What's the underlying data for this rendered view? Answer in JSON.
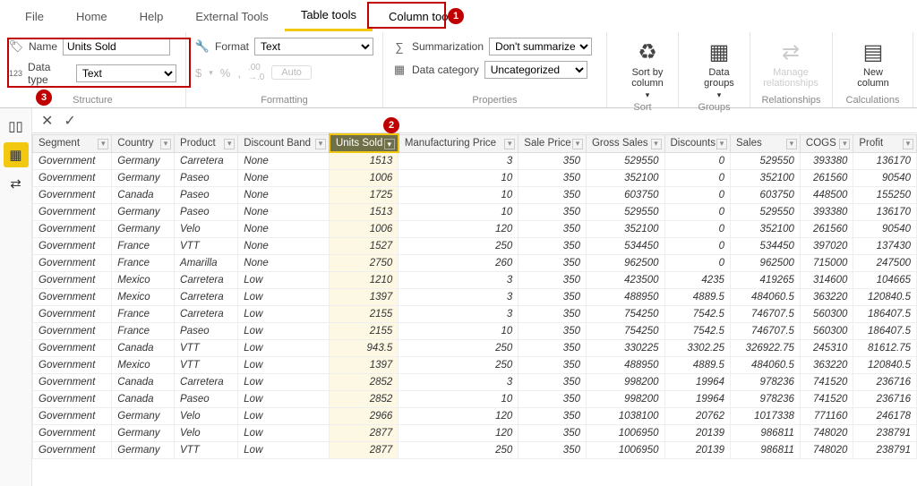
{
  "tabs": [
    "File",
    "Home",
    "Help",
    "External Tools",
    "Table tools",
    "Column tools"
  ],
  "structure": {
    "name_label": "Name",
    "name_value": "Units Sold",
    "datatype_label": "Data type",
    "datatype_value": "Text",
    "group": "Structure"
  },
  "formatting": {
    "format_label": "Format",
    "format_value": "Text",
    "auto": "Auto",
    "group": "Formatting"
  },
  "properties": {
    "sum_label": "Summarization",
    "sum_value": "Don't summarize",
    "cat_label": "Data category",
    "cat_value": "Uncategorized",
    "group": "Properties"
  },
  "sort": {
    "btn": "Sort by\ncolumn",
    "group": "Sort"
  },
  "groups": {
    "btn": "Data\ngroups",
    "group": "Groups"
  },
  "rel": {
    "btn": "Manage\nrelationships",
    "group": "Relationships"
  },
  "calc": {
    "btn": "New\ncolumn",
    "group": "Calculations"
  },
  "columns": [
    "Segment",
    "Country",
    "Product",
    "Discount Band",
    "Units Sold",
    "Manufacturing Price",
    "Sale Price",
    "Gross Sales",
    "Discounts",
    "Sales",
    "COGS",
    "Profit"
  ],
  "rows": [
    [
      "Government",
      "Germany",
      "Carretera",
      "None",
      "1513",
      "3",
      "350",
      "529550",
      "0",
      "529550",
      "393380",
      "136170"
    ],
    [
      "Government",
      "Germany",
      "Paseo",
      "None",
      "1006",
      "10",
      "350",
      "352100",
      "0",
      "352100",
      "261560",
      "90540"
    ],
    [
      "Government",
      "Canada",
      "Paseo",
      "None",
      "1725",
      "10",
      "350",
      "603750",
      "0",
      "603750",
      "448500",
      "155250"
    ],
    [
      "Government",
      "Germany",
      "Paseo",
      "None",
      "1513",
      "10",
      "350",
      "529550",
      "0",
      "529550",
      "393380",
      "136170"
    ],
    [
      "Government",
      "Germany",
      "Velo",
      "None",
      "1006",
      "120",
      "350",
      "352100",
      "0",
      "352100",
      "261560",
      "90540"
    ],
    [
      "Government",
      "France",
      "VTT",
      "None",
      "1527",
      "250",
      "350",
      "534450",
      "0",
      "534450",
      "397020",
      "137430"
    ],
    [
      "Government",
      "France",
      "Amarilla",
      "None",
      "2750",
      "260",
      "350",
      "962500",
      "0",
      "962500",
      "715000",
      "247500"
    ],
    [
      "Government",
      "Mexico",
      "Carretera",
      "Low",
      "1210",
      "3",
      "350",
      "423500",
      "4235",
      "419265",
      "314600",
      "104665"
    ],
    [
      "Government",
      "Mexico",
      "Carretera",
      "Low",
      "1397",
      "3",
      "350",
      "488950",
      "4889.5",
      "484060.5",
      "363220",
      "120840.5"
    ],
    [
      "Government",
      "France",
      "Carretera",
      "Low",
      "2155",
      "3",
      "350",
      "754250",
      "7542.5",
      "746707.5",
      "560300",
      "186407.5"
    ],
    [
      "Government",
      "France",
      "Paseo",
      "Low",
      "2155",
      "10",
      "350",
      "754250",
      "7542.5",
      "746707.5",
      "560300",
      "186407.5"
    ],
    [
      "Government",
      "Canada",
      "VTT",
      "Low",
      "943.5",
      "250",
      "350",
      "330225",
      "3302.25",
      "326922.75",
      "245310",
      "81612.75"
    ],
    [
      "Government",
      "Mexico",
      "VTT",
      "Low",
      "1397",
      "250",
      "350",
      "488950",
      "4889.5",
      "484060.5",
      "363220",
      "120840.5"
    ],
    [
      "Government",
      "Canada",
      "Carretera",
      "Low",
      "2852",
      "3",
      "350",
      "998200",
      "19964",
      "978236",
      "741520",
      "236716"
    ],
    [
      "Government",
      "Canada",
      "Paseo",
      "Low",
      "2852",
      "10",
      "350",
      "998200",
      "19964",
      "978236",
      "741520",
      "236716"
    ],
    [
      "Government",
      "Germany",
      "Velo",
      "Low",
      "2966",
      "120",
      "350",
      "1038100",
      "20762",
      "1017338",
      "771160",
      "246178"
    ],
    [
      "Government",
      "Germany",
      "Velo",
      "Low",
      "2877",
      "120",
      "350",
      "1006950",
      "20139",
      "986811",
      "748020",
      "238791"
    ],
    [
      "Government",
      "Germany",
      "VTT",
      "Low",
      "2877",
      "250",
      "350",
      "1006950",
      "20139",
      "986811",
      "748020",
      "238791"
    ]
  ]
}
